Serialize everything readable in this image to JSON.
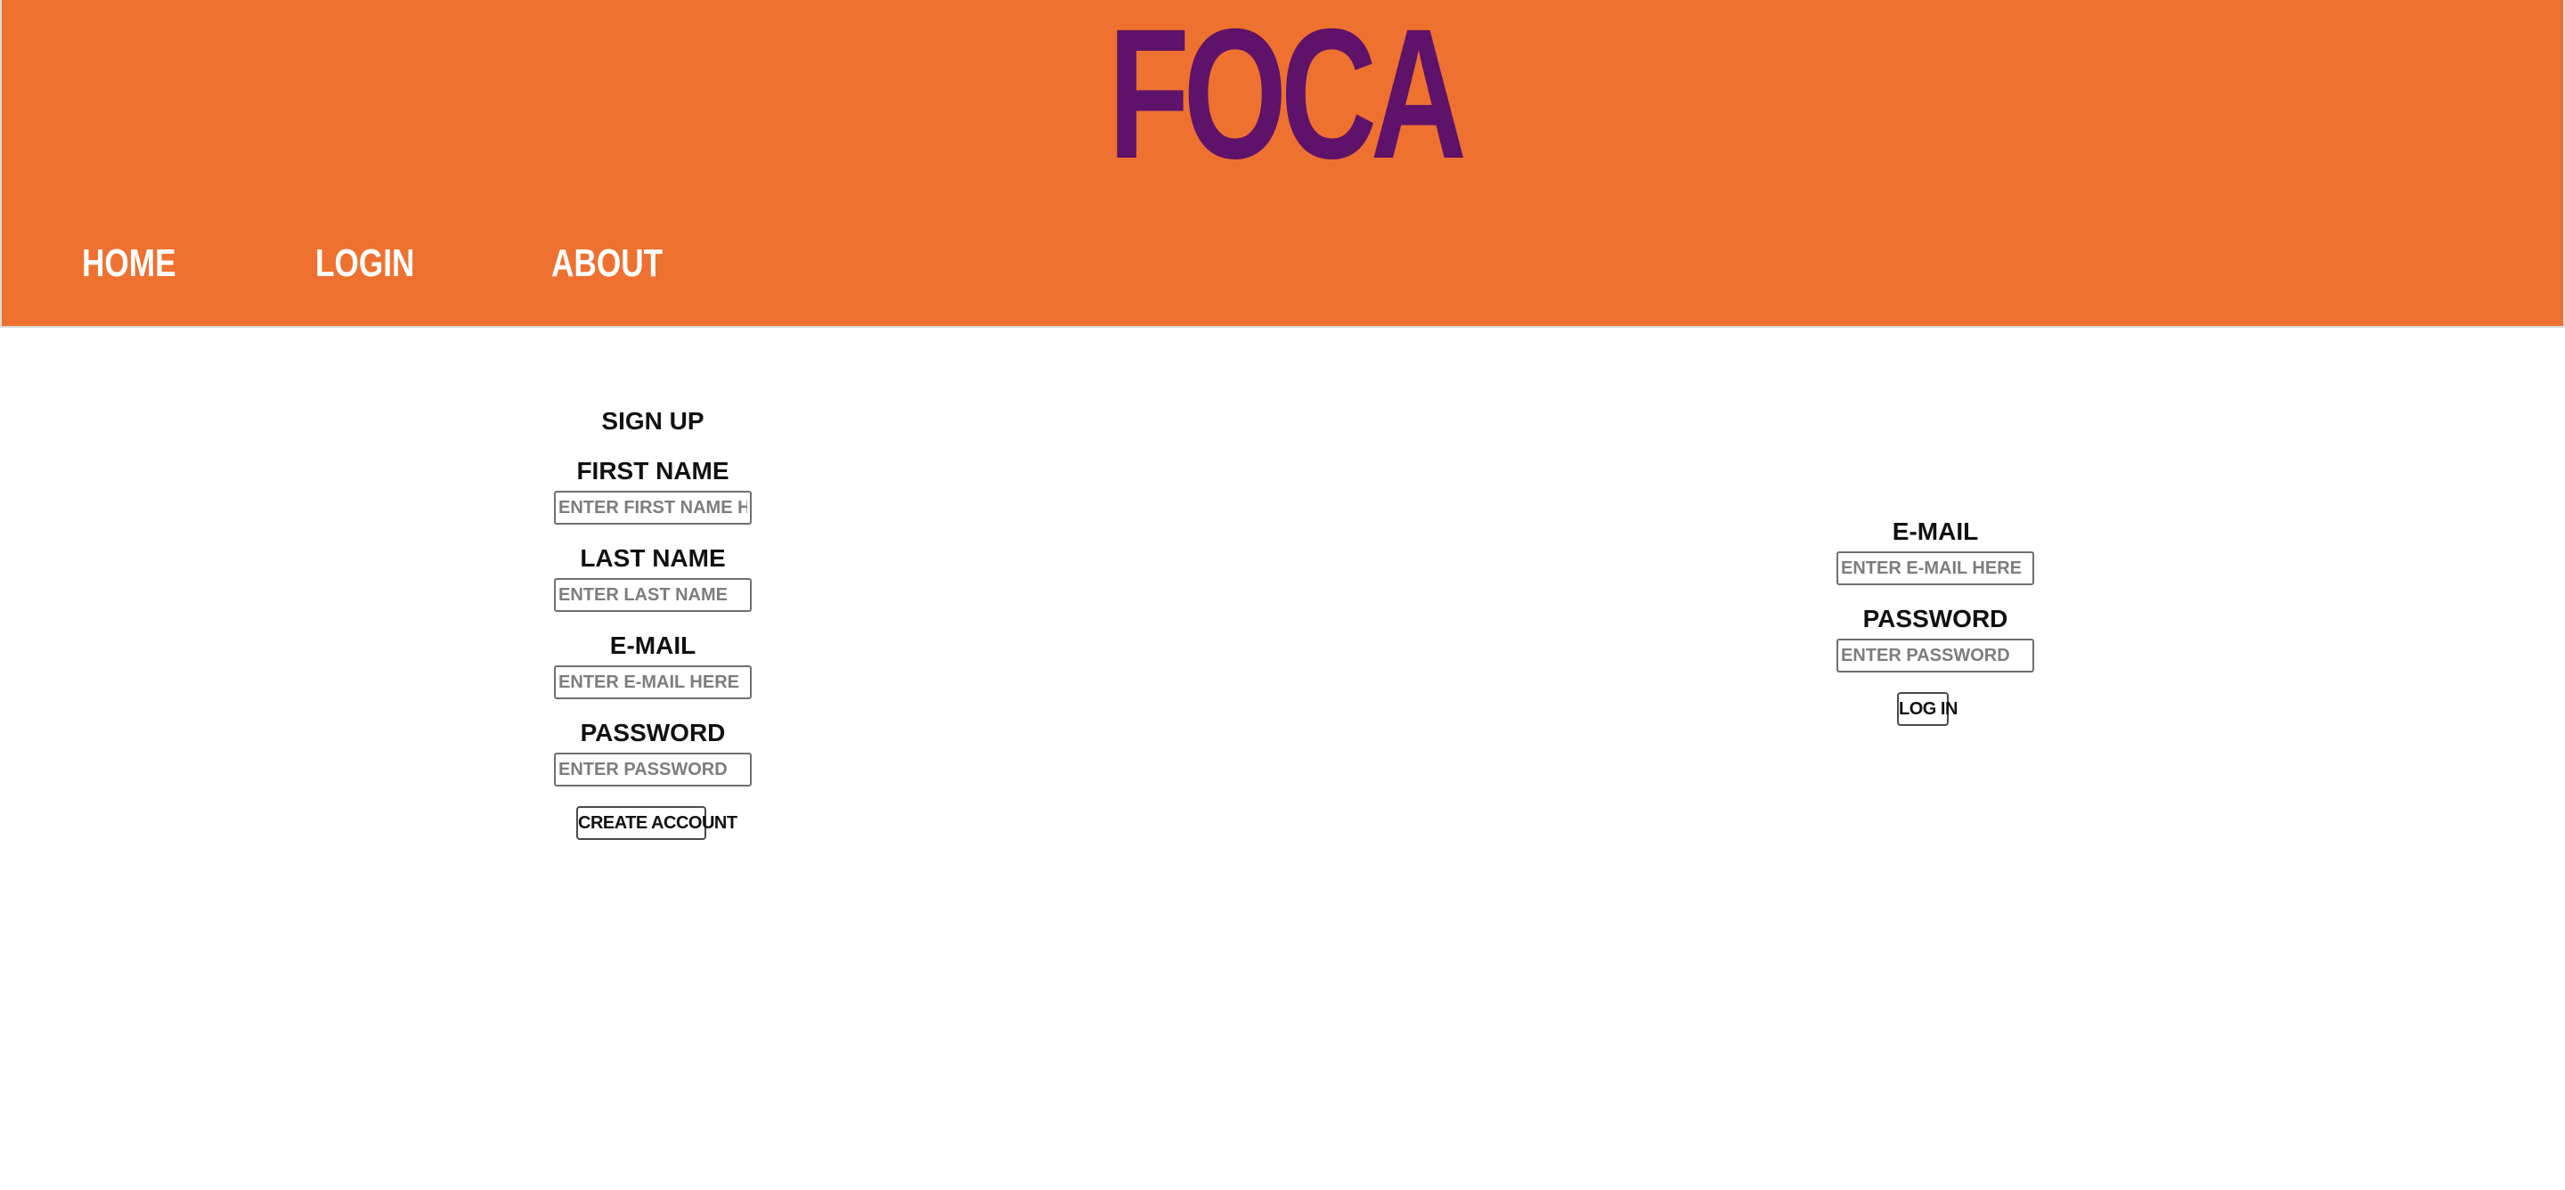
{
  "colors": {
    "header_background": "#ee712f",
    "logo": "#5e1269",
    "nav_text": "#ffffff",
    "page_background": "#ffffff"
  },
  "header": {
    "logo_text": "FOCA",
    "nav": {
      "home": "HOME",
      "login": "LOGIN",
      "about": "ABOUT"
    }
  },
  "signup": {
    "title": "SIGN UP",
    "first_name": {
      "label": "FIRST NAME",
      "placeholder": "ENTER FIRST NAME HERE",
      "value": ""
    },
    "last_name": {
      "label": "LAST NAME",
      "placeholder": "ENTER LAST NAME",
      "value": ""
    },
    "email": {
      "label": "E-MAIL",
      "placeholder": "ENTER E-MAIL HERE",
      "value": ""
    },
    "password": {
      "label": "PASSWORD",
      "placeholder": "ENTER PASSWORD",
      "value": ""
    },
    "submit_label": "CREATE ACCOUNT"
  },
  "login": {
    "email": {
      "label": "E-MAIL",
      "placeholder": "ENTER E-MAIL HERE",
      "value": ""
    },
    "password": {
      "label": "PASSWORD",
      "placeholder": "ENTER PASSWORD",
      "value": ""
    },
    "submit_label": "LOG IN"
  }
}
